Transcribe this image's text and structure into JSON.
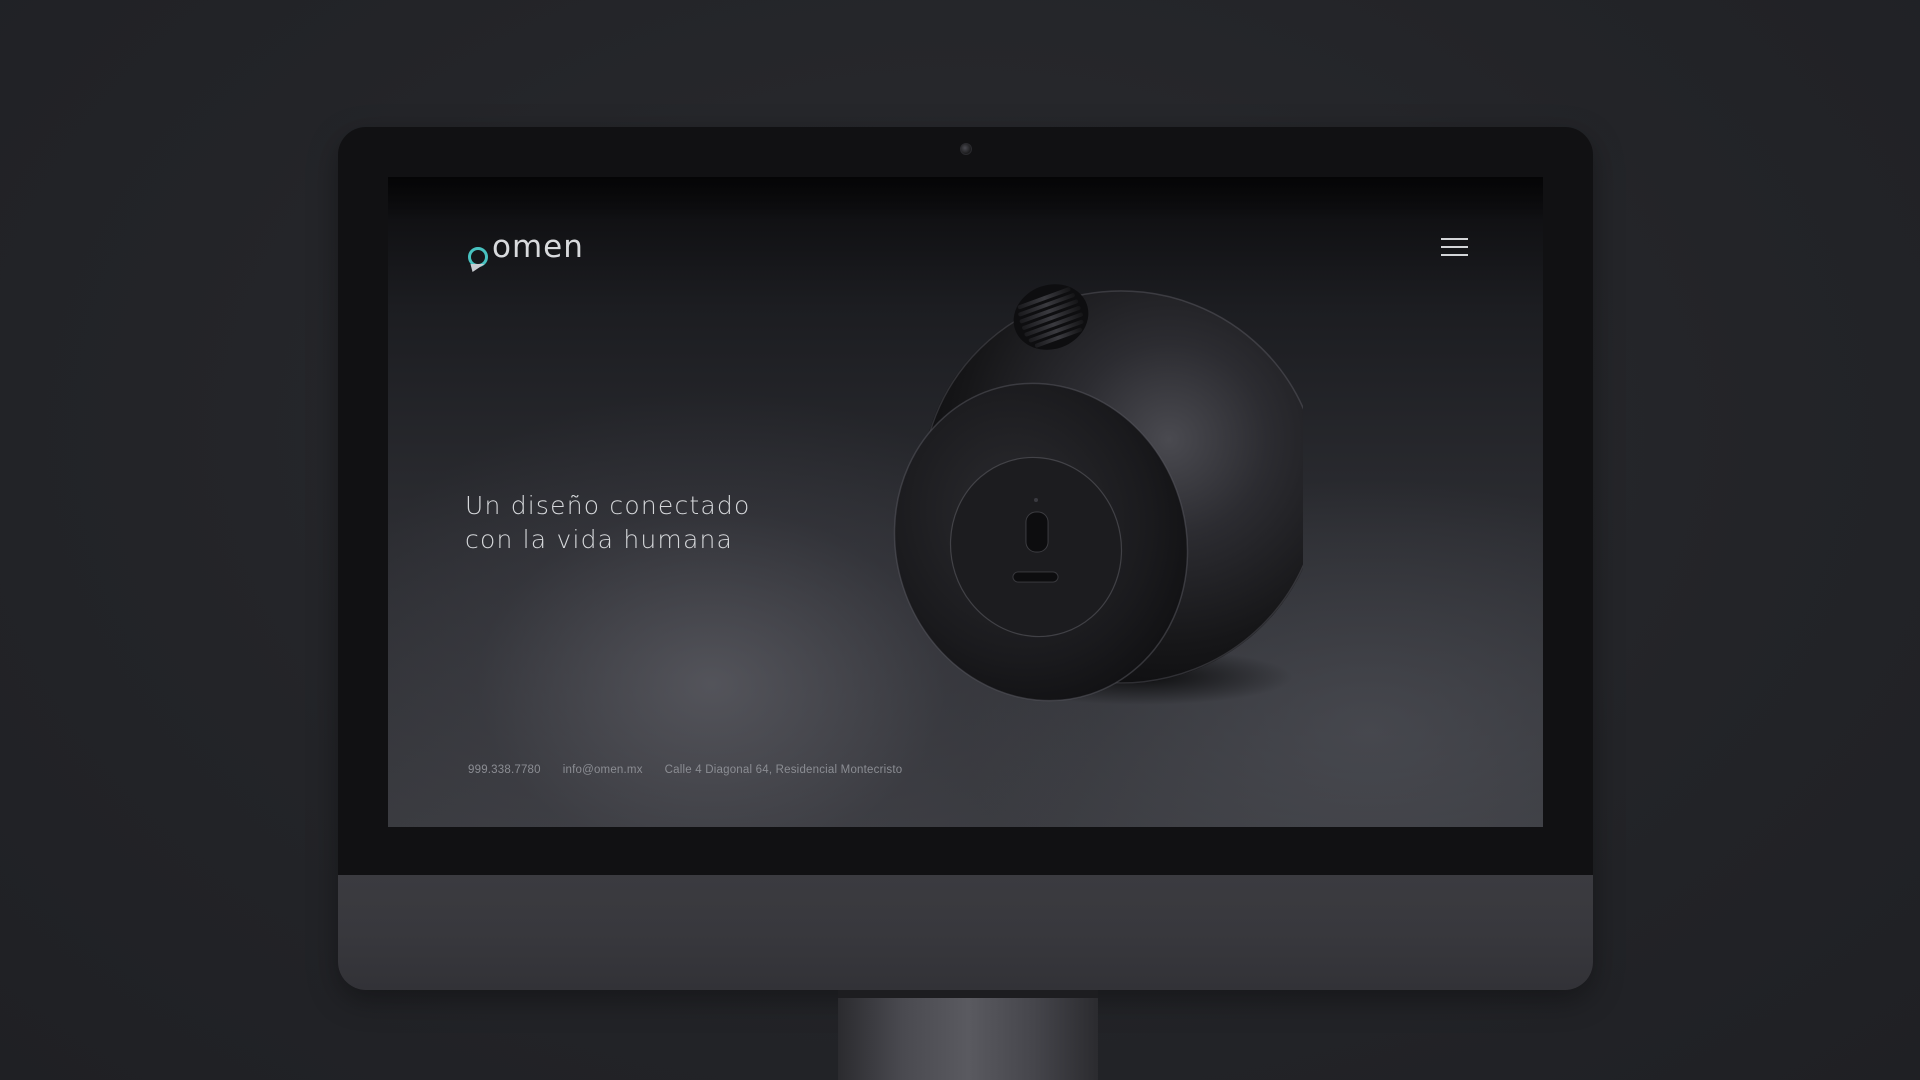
{
  "site": {
    "logo_text": "omen",
    "brand_color": "#48c2c0",
    "menu_icon": "hamburger-menu-icon"
  },
  "hero": {
    "line1": "Un diseño conectado",
    "line2": "con la vida humana"
  },
  "footer": {
    "phone": "999.338.7780",
    "email": "info@omen.mx",
    "address": "Calle 4 Diagonal 64, Residencial Montecristo"
  },
  "colors": {
    "background": "#26272b",
    "bezel": "#111113",
    "chin": "#38383d"
  }
}
